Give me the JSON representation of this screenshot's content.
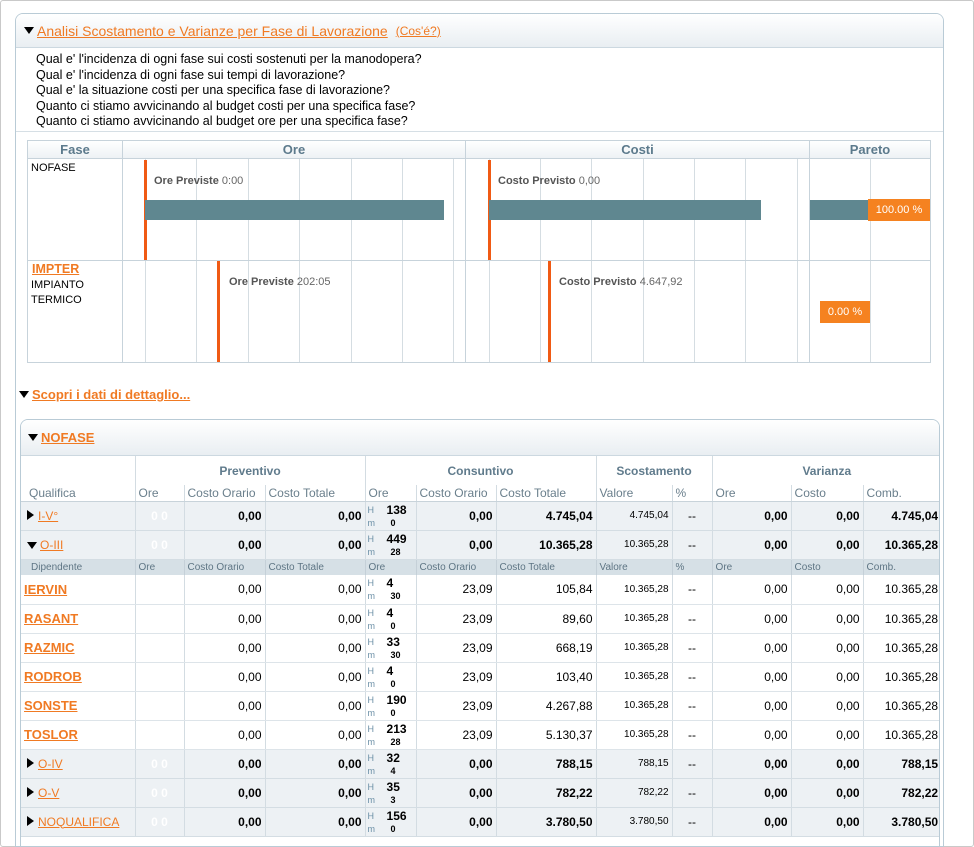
{
  "header": {
    "title": "Analisi Scostamento e Varianze per Fase di Lavorazione",
    "whats_this": "(Cos'é?)"
  },
  "questions": [
    "Qual e' l'incidenza di ogni fase sui costi sostenuti per la manodopera?",
    "Qual e' l'incidenza di ogni fase sui tempi di lavorazione?",
    "Qual e' la situazione costi per una specifica fase di lavorazione?",
    "Quanto ci stiamo avvicinando al budget costi per una specifica fase?",
    "Quanto ci stiamo avvicinando al budget ore per una specifica fase?"
  ],
  "phase_grid": {
    "columns": [
      "Fase",
      "Ore",
      "Costi",
      "Pareto"
    ],
    "rows": [
      {
        "code": "",
        "name": "NOFASE",
        "ore_label": "Ore Previste",
        "ore_value": "0:00",
        "costo_label": "Costo Previsto",
        "costo_value": "0,00",
        "pareto": "100.00 %",
        "pareto_fraction": 1.0
      },
      {
        "code": "IMPTER",
        "name": "IMPIANTO TERMICO",
        "ore_label": "Ore Previste",
        "ore_value": "202:05",
        "costo_label": "Costo Previsto",
        "costo_value": "4.647,92",
        "pareto": "0.00 %",
        "pareto_fraction": 0.0
      }
    ],
    "colors": {
      "bar": "#5f8790",
      "marker": "#f05a14",
      "badge": "#f58220"
    }
  },
  "detail_link": "Scopri i dati di dettaglio...",
  "detail": {
    "phase": "NOFASE",
    "groups": [
      "Preventivo",
      "Consuntivo",
      "Scostamento",
      "Varianza"
    ],
    "sub_headers": [
      "Qualifica",
      "Ore",
      "Costo Orario",
      "Costo Totale",
      "Ore",
      "Costo Orario",
      "Costo Totale",
      "Valore",
      "%",
      "Ore",
      "Costo",
      "Comb."
    ],
    "dep_headers": [
      "Dipendente",
      "Ore",
      "Costo Orario",
      "Costo Totale",
      "Ore",
      "Costo Orario",
      "Costo Totale",
      "Valore",
      "%",
      "Ore",
      "Costo",
      "Comb."
    ],
    "hm": {
      "h": "H",
      "m": "m"
    },
    "qualifiche": [
      {
        "name": "I-V°",
        "expanded": false,
        "prev_ore": "0 0",
        "prev_co": "0,00",
        "prev_ct": "0,00",
        "cons_h": "138",
        "cons_m": "0",
        "cons_co": "0,00",
        "cons_ct": "4.745,04",
        "sc_val": "4.745,04",
        "sc_pct": "--",
        "v_ore": "0,00",
        "v_costo": "0,00",
        "v_comb": "4.745,04",
        "dipendenti": []
      },
      {
        "name": "O-III",
        "expanded": true,
        "prev_ore": "0 0",
        "prev_co": "0,00",
        "prev_ct": "0,00",
        "cons_h": "449",
        "cons_m": "28",
        "cons_co": "0,00",
        "cons_ct": "10.365,28",
        "sc_val": "10.365,28",
        "sc_pct": "--",
        "v_ore": "0,00",
        "v_costo": "0,00",
        "v_comb": "10.365,28",
        "dipendenti": [
          {
            "name": "IERVIN",
            "prev_ore": "",
            "prev_co": "0,00",
            "prev_ct": "0,00",
            "cons_h": "4",
            "cons_m": "30",
            "cons_co": "23,09",
            "cons_ct": "105,84",
            "sc_val": "10.365,28",
            "sc_pct": "--",
            "v_ore": "0,00",
            "v_costo": "0,00",
            "v_comb": "10.365,28"
          },
          {
            "name": "RASANT",
            "prev_ore": "",
            "prev_co": "0,00",
            "prev_ct": "0,00",
            "cons_h": "4",
            "cons_m": "0",
            "cons_co": "23,09",
            "cons_ct": "89,60",
            "sc_val": "10.365,28",
            "sc_pct": "--",
            "v_ore": "0,00",
            "v_costo": "0,00",
            "v_comb": "10.365,28"
          },
          {
            "name": "RAZMIC",
            "prev_ore": "",
            "prev_co": "0,00",
            "prev_ct": "0,00",
            "cons_h": "33",
            "cons_m": "30",
            "cons_co": "23,09",
            "cons_ct": "668,19",
            "sc_val": "10.365,28",
            "sc_pct": "--",
            "v_ore": "0,00",
            "v_costo": "0,00",
            "v_comb": "10.365,28"
          },
          {
            "name": "RODROB",
            "prev_ore": "",
            "prev_co": "0,00",
            "prev_ct": "0,00",
            "cons_h": "4",
            "cons_m": "0",
            "cons_co": "23,09",
            "cons_ct": "103,40",
            "sc_val": "10.365,28",
            "sc_pct": "--",
            "v_ore": "0,00",
            "v_costo": "0,00",
            "v_comb": "10.365,28"
          },
          {
            "name": "SONSTE",
            "prev_ore": "",
            "prev_co": "0,00",
            "prev_ct": "0,00",
            "cons_h": "190",
            "cons_m": "0",
            "cons_co": "23,09",
            "cons_ct": "4.267,88",
            "sc_val": "10.365,28",
            "sc_pct": "--",
            "v_ore": "0,00",
            "v_costo": "0,00",
            "v_comb": "10.365,28"
          },
          {
            "name": "TOSLOR",
            "prev_ore": "",
            "prev_co": "0,00",
            "prev_ct": "0,00",
            "cons_h": "213",
            "cons_m": "28",
            "cons_co": "23,09",
            "cons_ct": "5.130,37",
            "sc_val": "10.365,28",
            "sc_pct": "--",
            "v_ore": "0,00",
            "v_costo": "0,00",
            "v_comb": "10.365,28"
          }
        ]
      },
      {
        "name": "O-IV",
        "expanded": false,
        "prev_ore": "0 0",
        "prev_co": "0,00",
        "prev_ct": "0,00",
        "cons_h": "32",
        "cons_m": "4",
        "cons_co": "0,00",
        "cons_ct": "788,15",
        "sc_val": "788,15",
        "sc_pct": "--",
        "v_ore": "0,00",
        "v_costo": "0,00",
        "v_comb": "788,15",
        "dipendenti": []
      },
      {
        "name": "O-V",
        "expanded": false,
        "prev_ore": "0 0",
        "prev_co": "0,00",
        "prev_ct": "0,00",
        "cons_h": "35",
        "cons_m": "3",
        "cons_co": "0,00",
        "cons_ct": "782,22",
        "sc_val": "782,22",
        "sc_pct": "--",
        "v_ore": "0,00",
        "v_costo": "0,00",
        "v_comb": "782,22",
        "dipendenti": []
      },
      {
        "name": "NOQUALIFICA",
        "expanded": false,
        "prev_ore": "0 0",
        "prev_co": "0,00",
        "prev_ct": "0,00",
        "cons_h": "156",
        "cons_m": "0",
        "cons_co": "0,00",
        "cons_ct": "3.780,50",
        "sc_val": "3.780,50",
        "sc_pct": "--",
        "v_ore": "0,00",
        "v_costo": "0,00",
        "v_comb": "3.780,50",
        "dipendenti": []
      }
    ]
  }
}
